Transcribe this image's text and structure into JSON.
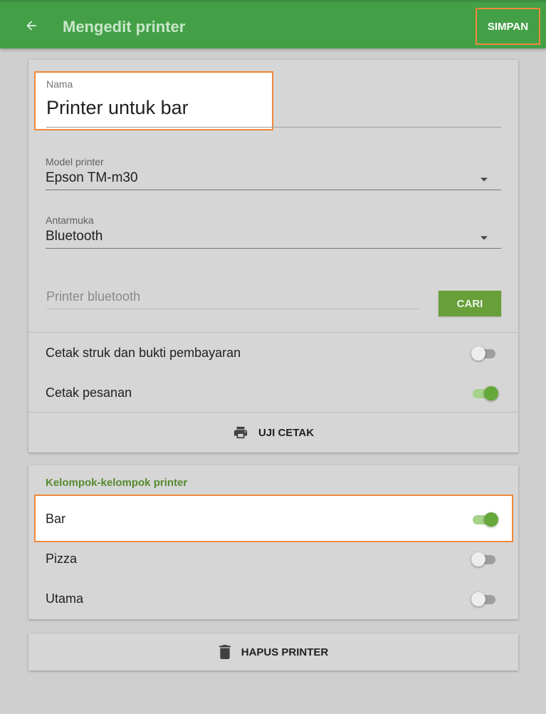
{
  "appbar": {
    "back_icon": "arrow-left-icon",
    "title": "Mengedit printer",
    "save_label": "SIMPAN",
    "bg_color": "#43a047",
    "highlight_color": "#f0883a"
  },
  "form": {
    "name_label": "Nama",
    "name_value": "Printer untuk bar",
    "model_label": "Model printer",
    "model_value": "Epson TM-m30",
    "interface_label": "Antarmuka",
    "interface_value": "Bluetooth",
    "bluetooth_placeholder": "Printer bluetooth",
    "search_label": "CARI"
  },
  "print_options": [
    {
      "label": "Cetak struk dan bukti pembayaran",
      "enabled": false
    },
    {
      "label": "Cetak pesanan",
      "enabled": true
    }
  ],
  "test_print": {
    "icon": "printer-icon",
    "label": "UJI CETAK"
  },
  "groups": {
    "title": "Kelompok-kelompok printer",
    "items": [
      {
        "label": "Bar",
        "enabled": true
      },
      {
        "label": "Pizza",
        "enabled": false
      },
      {
        "label": "Utama",
        "enabled": false
      }
    ]
  },
  "delete": {
    "icon": "trash-icon",
    "label": "HAPUS PRINTER"
  },
  "accent_color": "#66a839"
}
